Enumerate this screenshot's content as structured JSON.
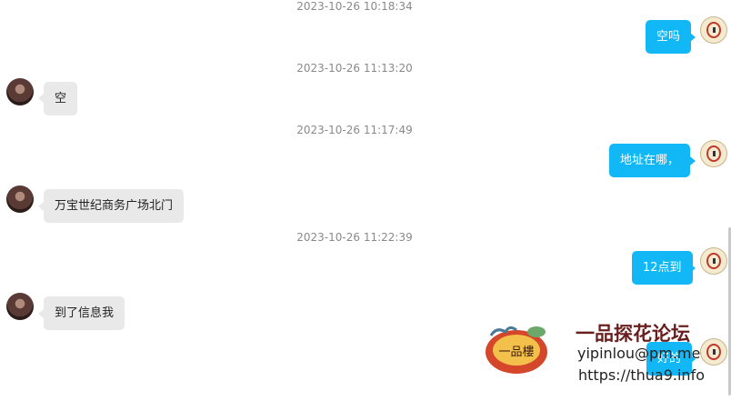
{
  "conversation": {
    "timestamps": [
      "2023-10-26 10:18:34",
      "2023-10-26 11:13:20",
      "2023-10-26 11:17:49",
      "2023-10-26 11:22:39"
    ],
    "messages": [
      {
        "direction": "out",
        "text": "空吗"
      },
      {
        "direction": "in",
        "text": "空"
      },
      {
        "direction": "out",
        "text": "地址在哪，"
      },
      {
        "direction": "in",
        "text": "万宝世纪商务广场北门"
      },
      {
        "direction": "out",
        "text": "12点到"
      },
      {
        "direction": "in",
        "text": "到了信息我"
      },
      {
        "direction": "out",
        "text": "好的"
      }
    ]
  },
  "watermark": {
    "logo_text": "一品樓",
    "title": "一品探花论坛",
    "email": "yipinlou@pm.me",
    "url": "https://thua9.info"
  },
  "colors": {
    "outgoing_bubble": "#12b7f5",
    "incoming_bubble": "#e9e9e9",
    "timestamp": "#8a8a8a"
  }
}
